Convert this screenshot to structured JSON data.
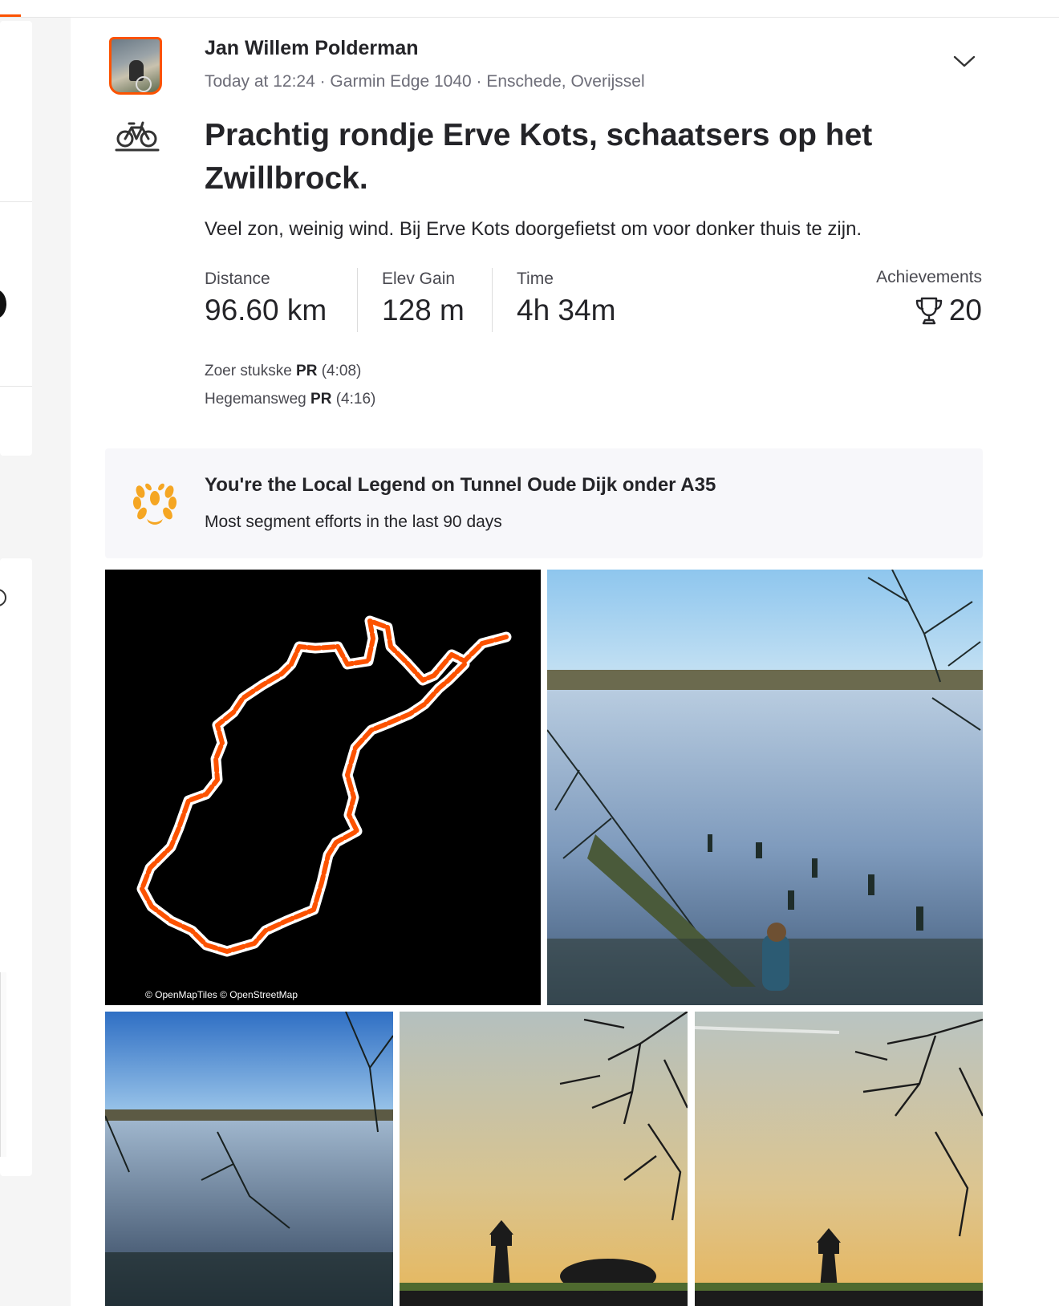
{
  "activity": {
    "athlete_name": "Jan Willem Polderman",
    "meta": "Today at 12:24 · Garmin Edge 1040 · Enschede, Overijssel",
    "title": "Prachtig rondje Erve Kots, schaatsers op het Zwillbrock.",
    "description": "Veel zon, weinig wind. Bij Erve Kots doorgefietst om voor donker thuis te zijn.",
    "sport_icon": "bike-icon"
  },
  "stats": {
    "distance_label": "Distance",
    "distance_value": "96.60 km",
    "elev_label": "Elev Gain",
    "elev_value": "128 m",
    "time_label": "Time",
    "time_value": "4h 34m",
    "achievements_label": "Achievements",
    "achievements_value": "20"
  },
  "prs": [
    {
      "segment": "Zoer stukske",
      "badge": "PR",
      "time": "(4:08)"
    },
    {
      "segment": "Hegemansweg",
      "badge": "PR",
      "time": "(4:16)"
    }
  ],
  "local_legend": {
    "title": "You're the Local Legend on Tunnel Oude Dijk onder A35",
    "subtitle": "Most segment efforts in the last 90 days"
  },
  "map": {
    "credit": "© OpenMapTiles © OpenStreetMap",
    "route_color": "#fc5200"
  },
  "colors": {
    "accent": "#fc5200",
    "legend_gold": "#f5a623",
    "text": "#242428",
    "muted": "#6d6d78"
  }
}
